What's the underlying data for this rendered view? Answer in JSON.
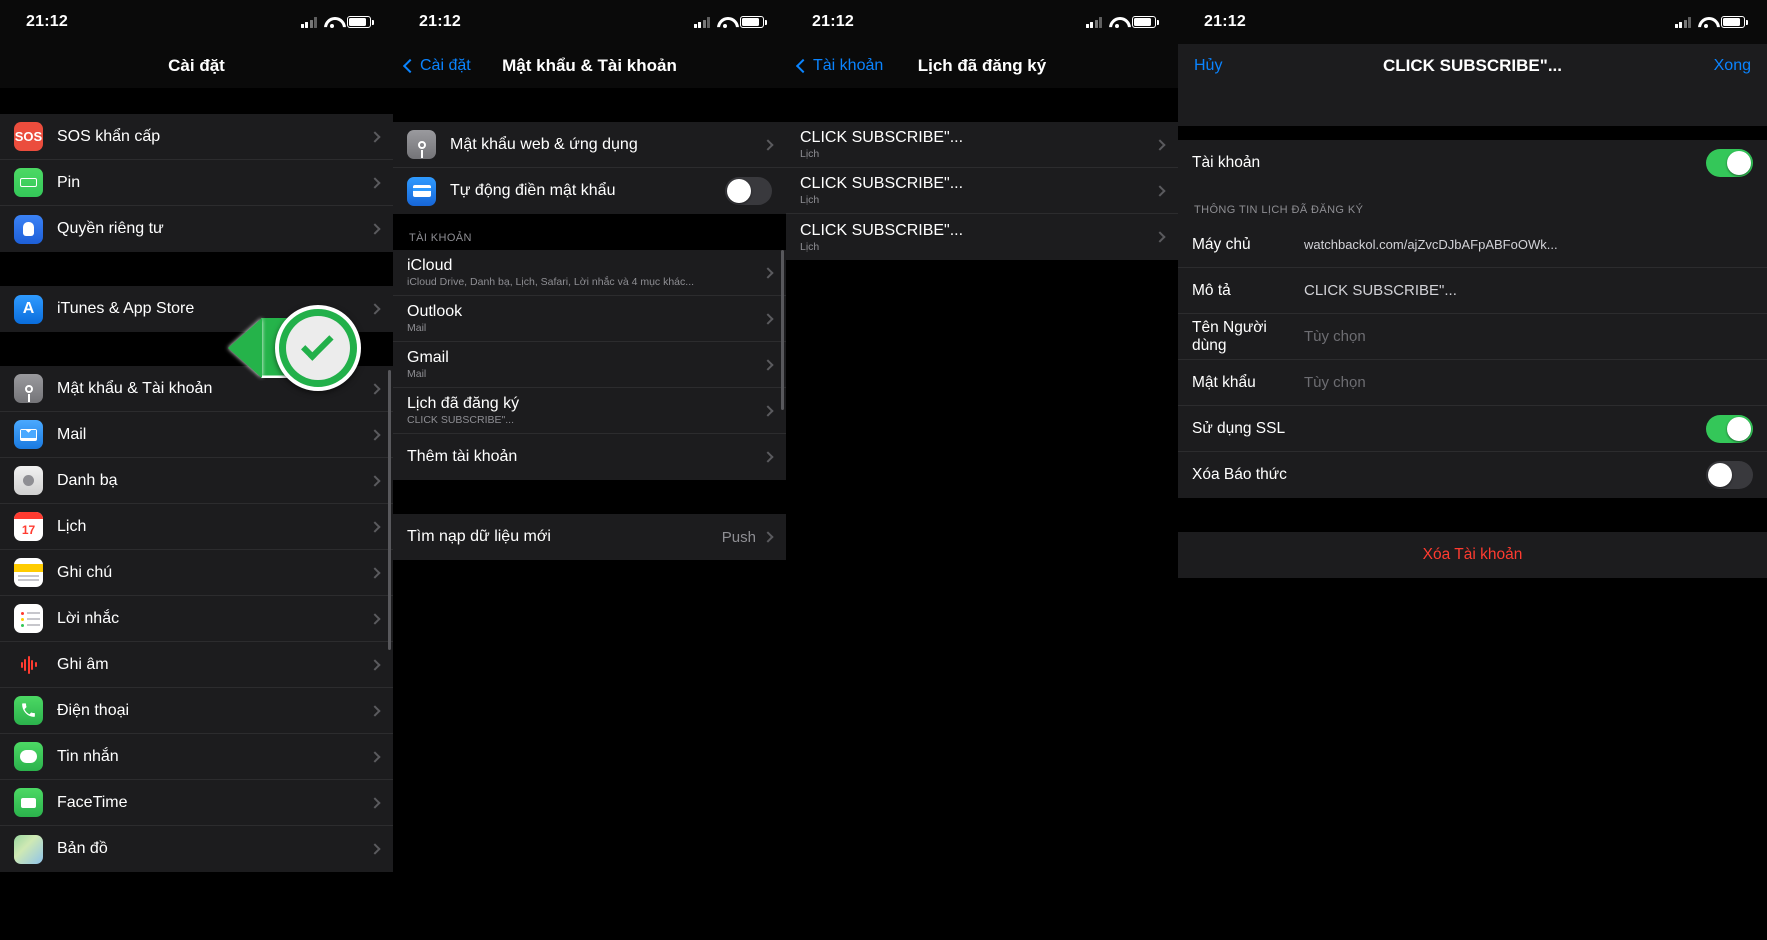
{
  "status": {
    "time": "21:12"
  },
  "panel1": {
    "title": "Cài đặt",
    "groups": [
      {
        "items": [
          {
            "label": "SOS khẩn cấp",
            "icon": "sos-icon"
          },
          {
            "label": "Pin",
            "icon": "battery-icon"
          },
          {
            "label": "Quyền riêng tư",
            "icon": "privacy-hand-icon"
          }
        ]
      },
      {
        "items": [
          {
            "label": "iTunes & App Store",
            "icon": "app-store-icon"
          }
        ]
      },
      {
        "items": [
          {
            "label": "Mật khẩu & Tài khoản",
            "icon": "key-icon"
          },
          {
            "label": "Mail",
            "icon": "mail-icon"
          },
          {
            "label": "Danh bạ",
            "icon": "contacts-icon"
          },
          {
            "label": "Lịch",
            "icon": "calendar-icon"
          },
          {
            "label": "Ghi chú",
            "icon": "notes-icon"
          },
          {
            "label": "Lời nhắc",
            "icon": "reminders-icon"
          },
          {
            "label": "Ghi âm",
            "icon": "voice-memos-icon"
          },
          {
            "label": "Điện thoại",
            "icon": "phone-icon"
          },
          {
            "label": "Tin nhắn",
            "icon": "messages-icon"
          },
          {
            "label": "FaceTime",
            "icon": "facetime-icon"
          },
          {
            "label": "Bản đồ",
            "icon": "maps-icon"
          }
        ]
      }
    ]
  },
  "panel2": {
    "back": "Cài đặt",
    "title": "Mật khẩu & Tài khoản",
    "rows": [
      {
        "label": "Mật khẩu web & ứng dụng",
        "icon": "key-icon"
      },
      {
        "label": "Tự động điền mật khẩu",
        "icon": "autofill-icon",
        "toggle": "off"
      }
    ],
    "section_header": "TÀI KHOẢN",
    "accounts": [
      {
        "label": "iCloud",
        "sub": "iCloud Drive, Danh bạ, Lịch, Safari, Lời nhắc và 4 mục khác..."
      },
      {
        "label": "Outlook",
        "sub": "Mail"
      },
      {
        "label": "Gmail",
        "sub": "Mail"
      },
      {
        "label": "Lịch đã đăng ký",
        "sub": "CLICK SUBSCRIBE\"..."
      },
      {
        "label": "Thêm tài khoản",
        "sub": ""
      }
    ],
    "fetch": {
      "label": "Tìm nạp dữ liệu mới",
      "value": "Push"
    }
  },
  "panel3": {
    "back": "Tài khoản",
    "title": "Lịch đã đăng ký",
    "items": [
      {
        "label": "CLICK SUBSCRIBE\"...",
        "sub": "Lịch"
      },
      {
        "label": "CLICK SUBSCRIBE\"...",
        "sub": "Lịch"
      },
      {
        "label": "CLICK SUBSCRIBE\"...",
        "sub": "Lịch"
      }
    ]
  },
  "panel4": {
    "cancel": "Hủy",
    "title": "CLICK SUBSCRIBE\"...",
    "done": "Xong",
    "account_row": {
      "label": "Tài khoản",
      "toggle": "on"
    },
    "section_header": "THÔNG TIN LỊCH ĐÃ ĐĂNG KÝ",
    "fields": [
      {
        "label": "Máy chủ",
        "value": "watchbackol.com/ajZvcDJbAFpABFoOWk..."
      },
      {
        "label": "Mô tả",
        "value": "CLICK SUBSCRIBE\"..."
      },
      {
        "label": "Tên Người dùng",
        "placeholder": "Tùy chọn"
      },
      {
        "label": "Mật khẩu",
        "placeholder": "Tùy chọn"
      }
    ],
    "toggles": [
      {
        "label": "Sử dụng SSL",
        "state": "on"
      },
      {
        "label": "Xóa Báo thức",
        "state": "off"
      }
    ],
    "delete": "Xóa Tài khoản"
  },
  "colors": {
    "accent_blue": "#0a84ff",
    "toggle_green": "#34c759",
    "destructive_red": "#ff3b30",
    "annotation_green": "#22b04a",
    "list_bg": "#1c1c1e"
  }
}
